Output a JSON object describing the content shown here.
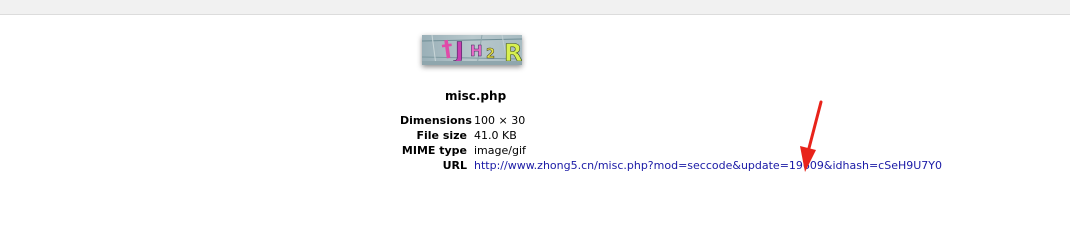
{
  "image": {
    "filename": "misc.php",
    "icon": "captcha-image"
  },
  "info": {
    "rows": [
      {
        "label": "Dimensions",
        "value": "100 × 30"
      },
      {
        "label": "File size",
        "value": "41.0 KB"
      },
      {
        "label": "MIME type",
        "value": "image/gif"
      },
      {
        "label": "URL",
        "value": "http://www.zhong5.cn/misc.php?mod=seccode&update=19609&idhash=cSeH9U7Y0"
      }
    ]
  },
  "colors": {
    "link": "#1a1aa6",
    "annotation_arrow": "#e8231a",
    "top_bar": "#f1f1f1"
  }
}
